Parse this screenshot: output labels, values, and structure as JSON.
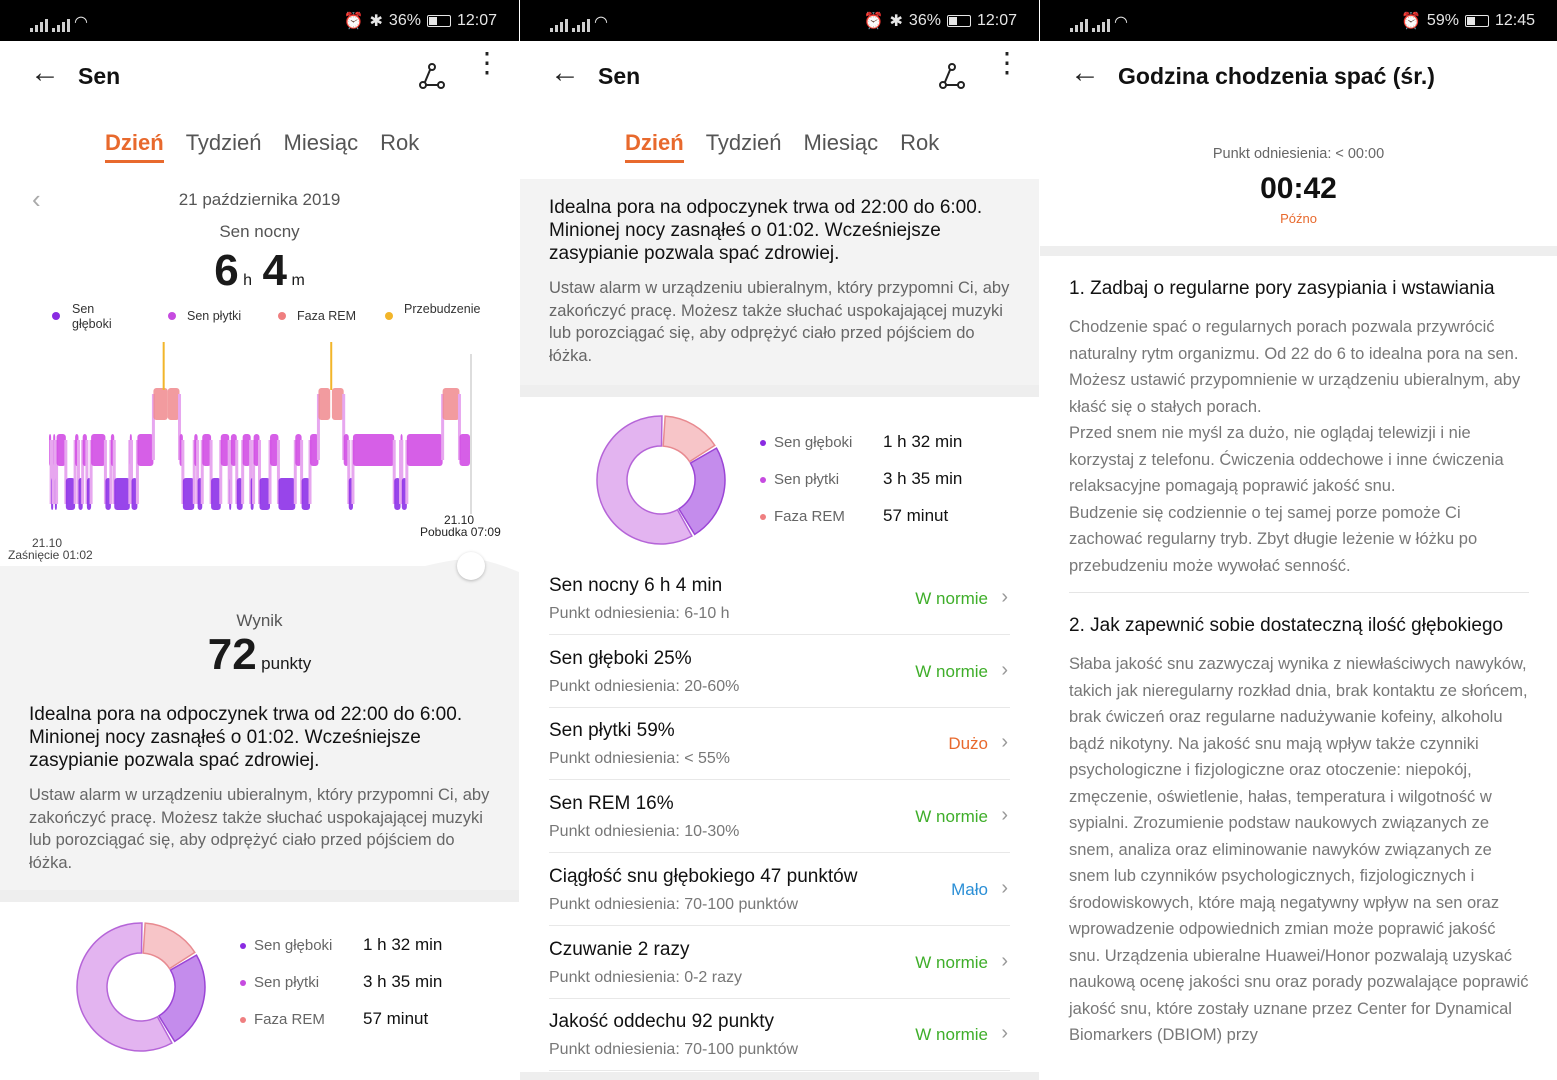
{
  "status_bar": {
    "p1": {
      "battery": "36%",
      "time": "12:07"
    },
    "p2": {
      "battery": "36%",
      "time": "12:07"
    },
    "p3": {
      "battery": "59%",
      "time": "12:45"
    }
  },
  "app": {
    "title": "Sen",
    "detail_title": "Godzina chodzenia spać (śr.)"
  },
  "tabs": [
    "Dzień",
    "Tydzień",
    "Miesiąc",
    "Rok"
  ],
  "day": {
    "date": "21 października 2019",
    "label": "Sen nocny",
    "hours": "6",
    "h_unit": "h",
    "minutes": "4",
    "m_unit": "m"
  },
  "stage_legend": [
    {
      "label": "Sen głęboki",
      "color": "#8a2be2"
    },
    {
      "label": "Sen płytki",
      "color": "#c64be0"
    },
    {
      "label": "Faza REM",
      "color": "#ef7f80"
    },
    {
      "label": "Przebudzenie",
      "color": "#f2b52a"
    }
  ],
  "chart_meta": {
    "start_date": "21.10",
    "start_label": "Zaśnięcie 01:02",
    "end_date": "21.10",
    "end_label": "Pobudka 07:09"
  },
  "score": {
    "label": "Wynik",
    "value": "72",
    "unit": "punkty"
  },
  "ideal": {
    "main": "Idealna pora na odpoczynek trwa od 22:00 do 6:00. Minionej nocy zasnąłeś o 01:02. Wcześniejsze zasypianie pozwala spać zdrowiej.",
    "sub": "Ustaw alarm w urządzeniu ubieralnym, który przypomni Ci, aby zakończyć pracę. Możesz także słuchać uspokajającej muzyki lub porozciągać się, aby odprężyć ciało przed pójściem do łóżka."
  },
  "chart_data": {
    "type": "pie",
    "categories": [
      "Sen głęboki",
      "Sen płytki",
      "Faza REM"
    ],
    "values": [
      92,
      215,
      57
    ],
    "display_values": [
      "1 h 32 min",
      "3 h 35 min",
      "57 minut"
    ],
    "colors": [
      "#c48cec",
      "#e3b4f0",
      "#f7c5c8"
    ]
  },
  "metrics": [
    {
      "title": "Sen nocny  6 h 4 min",
      "ref": "Punkt odniesienia: 6-10 h",
      "status": "W normie",
      "color": "#3fae2a"
    },
    {
      "title": "Sen głęboki  25%",
      "ref": "Punkt odniesienia: 20-60%",
      "status": "W normie",
      "color": "#3fae2a"
    },
    {
      "title": "Sen płytki  59%",
      "ref": "Punkt odniesienia: < 55%",
      "status": "Dużo",
      "color": "#e8692d"
    },
    {
      "title": "Sen REM  16%",
      "ref": "Punkt odniesienia: 10-30%",
      "status": "W normie",
      "color": "#3fae2a"
    },
    {
      "title": "Ciągłość snu głębokiego  47 punktów",
      "ref": "Punkt odniesienia: 70-100 punktów",
      "status": "Mało",
      "color": "#2b8fd6"
    },
    {
      "title": "Czuwanie  2 razy",
      "ref": "Punkt odniesienia: 0-2 razy",
      "status": "W normie",
      "color": "#3fae2a"
    },
    {
      "title": "Jakość oddechu  92 punkty",
      "ref": "Punkt odniesienia: 70-100 punktów",
      "status": "W normie",
      "color": "#3fae2a"
    }
  ],
  "bedtime": {
    "ref": "Punkt odniesienia: < 00:00",
    "time": "00:42",
    "status": "Późno"
  },
  "advice": [
    {
      "title": "1. Zadbaj o regularne pory zasypiania i wstawiania",
      "paragraphs": [
        "Chodzenie spać o regularnych porach pozwala przywrócić naturalny rytm organizmu. Od 22 do 6 to idealna pora na sen. Możesz ustawić przypomnienie w urządzeniu ubieralnym, aby kłaść się o stałych porach.",
        "Przed snem nie myśl za dużo, nie oglądaj telewizji i nie korzystaj z telefonu. Ćwiczenia oddechowe i inne ćwiczenia relaksacyjne pomagają poprawić jakość snu.",
        "Budzenie się codziennie o tej samej porze pomoże Ci zachować regularny tryb. Zbyt długie leżenie w łóżku po przebudzeniu może wywołać senność."
      ]
    },
    {
      "title": "2. Jak zapewnić sobie dostateczną ilość głębokiego",
      "paragraphs": [
        "Słaba jakość snu zazwyczaj wynika z niewłaściwych nawyków, takich jak nieregularny rozkład dnia, brak kontaktu ze słońcem, brak ćwiczeń oraz regularne nadużywanie kofeiny, alkoholu bądź nikotyny. Na jakość snu mają wpływ także czynniki psychologiczne i fizjologiczne oraz otoczenie: niepokój, zmęczenie, oświetlenie, hałas, temperatura i wilgotność w sypialni. Zrozumienie podstaw naukowych związanych ze snem, analiza oraz eliminowanie nawyków związanych ze snem lub czynników psychologicznych, fizjologicznych i środowiskowych, które mają negatywny wpływ na sen oraz wprowadzenie odpowiednich zmian może poprawić jakość snu. Urządzenia ubieralne Huawei/Honor pozwalają uzyskać naukową ocenę jakości snu oraz porady pozwalające poprawić jakość snu, które zostały uznane przez Center for Dynamical Biomarkers (DBIOM) przy"
      ]
    }
  ],
  "sleep_segments": [
    [
      "s",
      0.0,
      0.005
    ],
    [
      "d",
      0.005,
      0.01
    ],
    [
      "s",
      0.01,
      0.014
    ],
    [
      "d",
      0.014,
      0.018
    ],
    [
      "s",
      0.018,
      0.04
    ],
    [
      "d",
      0.04,
      0.062
    ],
    [
      "s",
      0.062,
      0.07
    ],
    [
      "d",
      0.07,
      0.08
    ],
    [
      "s",
      0.08,
      0.09
    ],
    [
      "d",
      0.09,
      0.1
    ],
    [
      "s",
      0.1,
      0.134
    ],
    [
      "d",
      0.134,
      0.147
    ],
    [
      "s",
      0.147,
      0.155
    ],
    [
      "d",
      0.155,
      0.192
    ],
    [
      "s",
      0.192,
      0.196
    ],
    [
      "d",
      0.196,
      0.21
    ],
    [
      "s",
      0.21,
      0.248
    ],
    [
      "r",
      0.248,
      0.282
    ],
    [
      "a",
      0.27,
      0.274
    ],
    [
      "r",
      0.282,
      0.31
    ],
    [
      "s",
      0.31,
      0.318
    ],
    [
      "d",
      0.318,
      0.345
    ],
    [
      "s",
      0.345,
      0.353
    ],
    [
      "d",
      0.353,
      0.364
    ],
    [
      "s",
      0.364,
      0.385
    ],
    [
      "d",
      0.385,
      0.408
    ],
    [
      "s",
      0.408,
      0.428
    ],
    [
      "d",
      0.428,
      0.432
    ],
    [
      "s",
      0.432,
      0.446
    ],
    [
      "d",
      0.446,
      0.46
    ],
    [
      "s",
      0.46,
      0.479
    ],
    [
      "d",
      0.479,
      0.486
    ],
    [
      "s",
      0.486,
      0.5
    ],
    [
      "d",
      0.5,
      0.525
    ],
    [
      "s",
      0.525,
      0.545
    ],
    [
      "d",
      0.545,
      0.585
    ],
    [
      "s",
      0.585,
      0.6
    ],
    [
      "d",
      0.6,
      0.62
    ],
    [
      "s",
      0.62,
      0.64
    ],
    [
      "r",
      0.64,
      0.668
    ],
    [
      "a",
      0.668,
      0.672
    ],
    [
      "r",
      0.672,
      0.7
    ],
    [
      "s",
      0.7,
      0.712
    ],
    [
      "d",
      0.712,
      0.722
    ],
    [
      "s",
      0.722,
      0.82
    ],
    [
      "d",
      0.82,
      0.835
    ],
    [
      "s",
      0.835,
      0.838
    ],
    [
      "d",
      0.838,
      0.85
    ],
    [
      "s",
      0.85,
      0.935
    ],
    [
      "r",
      0.935,
      0.975
    ],
    [
      "s",
      0.975,
      1.0
    ]
  ]
}
